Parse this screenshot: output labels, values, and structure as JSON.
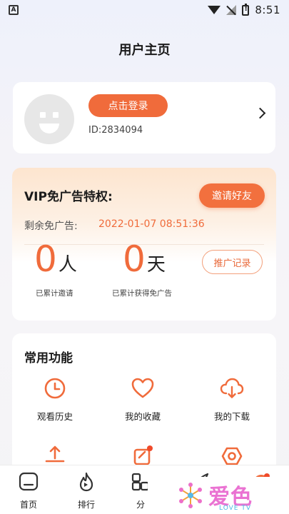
{
  "status_bar": {
    "time": "8:51",
    "left_icon": "A"
  },
  "header": {
    "title": "用户主页"
  },
  "profile": {
    "login_label": "点击登录",
    "user_id": "ID:2834094"
  },
  "vip": {
    "title": "VIP免广告特权:",
    "invite_label": "邀请好友",
    "remaining_label": "剩余免广告:",
    "remaining_value": "2022-01-07 08:51:36",
    "invited_count": "0",
    "invited_unit": "人",
    "invited_label": "已累计邀请",
    "days_count": "0",
    "days_unit": "天",
    "days_label": "已累计获得免广告",
    "promo_label": "推广记录"
  },
  "functions": {
    "title": "常用功能",
    "items": [
      {
        "label": "观看历史",
        "icon": "clock-icon"
      },
      {
        "label": "我的收藏",
        "icon": "heart-icon"
      },
      {
        "label": "我的下载",
        "icon": "cloud-download-icon"
      },
      {
        "label": "",
        "icon": "upload-icon"
      },
      {
        "label": "",
        "icon": "edit-icon"
      },
      {
        "label": "",
        "icon": "settings-icon"
      }
    ]
  },
  "tabs": [
    {
      "label": "首页",
      "icon": "home-icon"
    },
    {
      "label": "排行",
      "icon": "flame-icon"
    },
    {
      "label": "分",
      "icon": "category-icon"
    },
    {
      "label": "",
      "icon": "rocket-icon"
    },
    {
      "label": "",
      "icon": "profile-icon"
    }
  ],
  "watermark": {
    "text": "爱色",
    "sub": "LOVE TV",
    "color": "#ea72d2"
  },
  "colors": {
    "accent": "#f06b3b"
  }
}
